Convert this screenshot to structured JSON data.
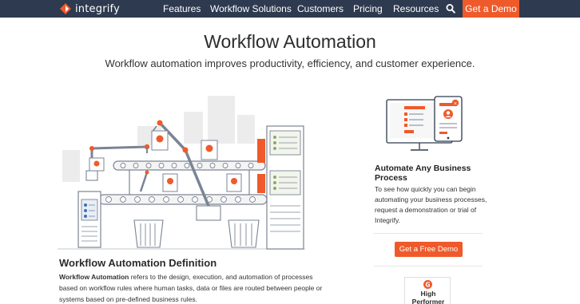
{
  "nav": {
    "logo_text": "integrify",
    "links": [
      "Features",
      "Workflow Solutions",
      "Customers",
      "Pricing",
      "Resources"
    ],
    "search_icon": "search-icon",
    "cta_label": "Get a Demo"
  },
  "hero": {
    "title": "Workflow Automation",
    "subtitle": "Workflow automation improves productivity, efficiency, and customer experience."
  },
  "definition": {
    "title": "Workflow Automation Definition",
    "bold_lead": "Workflow Automation",
    "body": " refers to the design, execution, and automation of processes based on workflow rules where human tasks, data or files are routed between people or systems based on pre-defined business rules."
  },
  "sidebar": {
    "heading": "Automate Any Business Process",
    "text": "To see how quickly you can begin automating your business processes, request a demonstration or trial of Integrify.",
    "button_label": "Get a Free Demo",
    "badge": {
      "line1": "High",
      "line2": "Performer",
      "icon": "g2-icon"
    }
  },
  "colors": {
    "nav_bg": "#2d3a4f",
    "accent": "#ef5a2b",
    "text": "#222222"
  }
}
